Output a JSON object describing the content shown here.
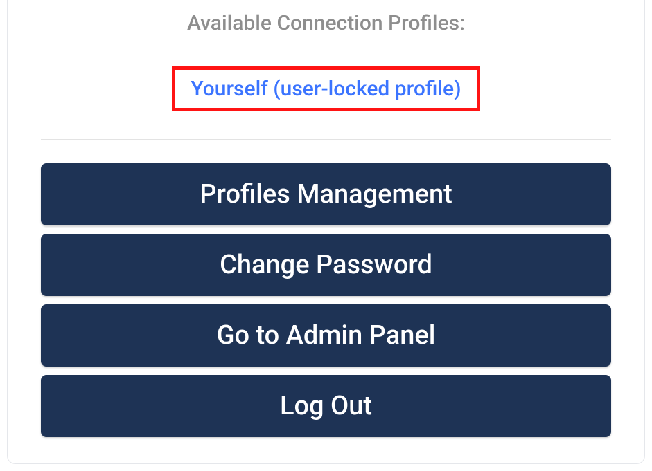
{
  "profiles": {
    "title": "Available Connection Profiles:",
    "highlighted_link": "Yourself (user-locked profile)"
  },
  "buttons": {
    "profiles_management": "Profiles Management",
    "change_password": "Change Password",
    "admin_panel": "Go to Admin Panel",
    "log_out": "Log Out"
  }
}
